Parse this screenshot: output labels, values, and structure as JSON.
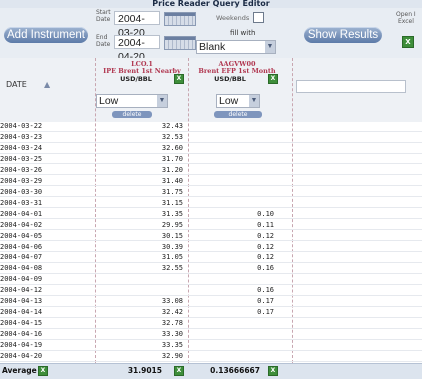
{
  "window": {
    "title": "Price Reader Query Editor"
  },
  "toolbar": {
    "add_instrument_label": "Add Instrument",
    "start_label_top": "Start",
    "start_label_bottom": "Date",
    "start_date": "2004-03-20",
    "end_label_top": "End",
    "end_label_bottom": "Date",
    "end_date": "2004-04-20",
    "weekends_label": "Weekends",
    "weekends_checked": false,
    "fill_with_label": "fill with",
    "fill_with_value": "Blank",
    "show_results_label": "Show Results",
    "open_excel_label_top": "Open I",
    "open_excel_label_bottom": "Excel",
    "calendar_icon": "calendar-icon",
    "excel_icon": "excel-icon"
  },
  "grid": {
    "date_header": "DATE",
    "sort_icon": "sort-asc-icon",
    "columns": [
      {
        "code": "LCO.1",
        "name": "IPE Brent 1st Nearby",
        "unit": "USD/BBL",
        "select": "Low",
        "delete_label": "delete"
      },
      {
        "code": "AAGVW00",
        "name": "Brent EFP 1st Month",
        "unit": "USD/BBL",
        "select": "Low",
        "delete_label": "delete"
      }
    ],
    "rows": [
      {
        "date": "2004-03-22",
        "a": "32.43",
        "b": ""
      },
      {
        "date": "2004-03-23",
        "a": "32.53",
        "b": ""
      },
      {
        "date": "2004-03-24",
        "a": "32.60",
        "b": ""
      },
      {
        "date": "2004-03-25",
        "a": "31.70",
        "b": ""
      },
      {
        "date": "2004-03-26",
        "a": "31.20",
        "b": ""
      },
      {
        "date": "2004-03-29",
        "a": "31.40",
        "b": ""
      },
      {
        "date": "2004-03-30",
        "a": "31.75",
        "b": ""
      },
      {
        "date": "2004-03-31",
        "a": "31.15",
        "b": ""
      },
      {
        "date": "2004-04-01",
        "a": "31.35",
        "b": "0.10"
      },
      {
        "date": "2004-04-02",
        "a": "29.95",
        "b": "0.11"
      },
      {
        "date": "2004-04-05",
        "a": "30.15",
        "b": "0.12"
      },
      {
        "date": "2004-04-06",
        "a": "30.39",
        "b": "0.12"
      },
      {
        "date": "2004-04-07",
        "a": "31.05",
        "b": "0.12"
      },
      {
        "date": "2004-04-08",
        "a": "32.55",
        "b": "0.16"
      },
      {
        "date": "2004-04-09",
        "a": "",
        "b": ""
      },
      {
        "date": "2004-04-12",
        "a": "",
        "b": "0.16"
      },
      {
        "date": "2004-04-13",
        "a": "33.08",
        "b": "0.17"
      },
      {
        "date": "2004-04-14",
        "a": "32.42",
        "b": "0.17"
      },
      {
        "date": "2004-04-15",
        "a": "32.78",
        "b": ""
      },
      {
        "date": "2004-04-16",
        "a": "33.30",
        "b": ""
      },
      {
        "date": "2004-04-19",
        "a": "33.35",
        "b": ""
      },
      {
        "date": "2004-04-20",
        "a": "32.90",
        "b": ""
      }
    ],
    "footer": {
      "label": "Average",
      "a": "31.9015",
      "b": "0.13666667"
    }
  }
}
